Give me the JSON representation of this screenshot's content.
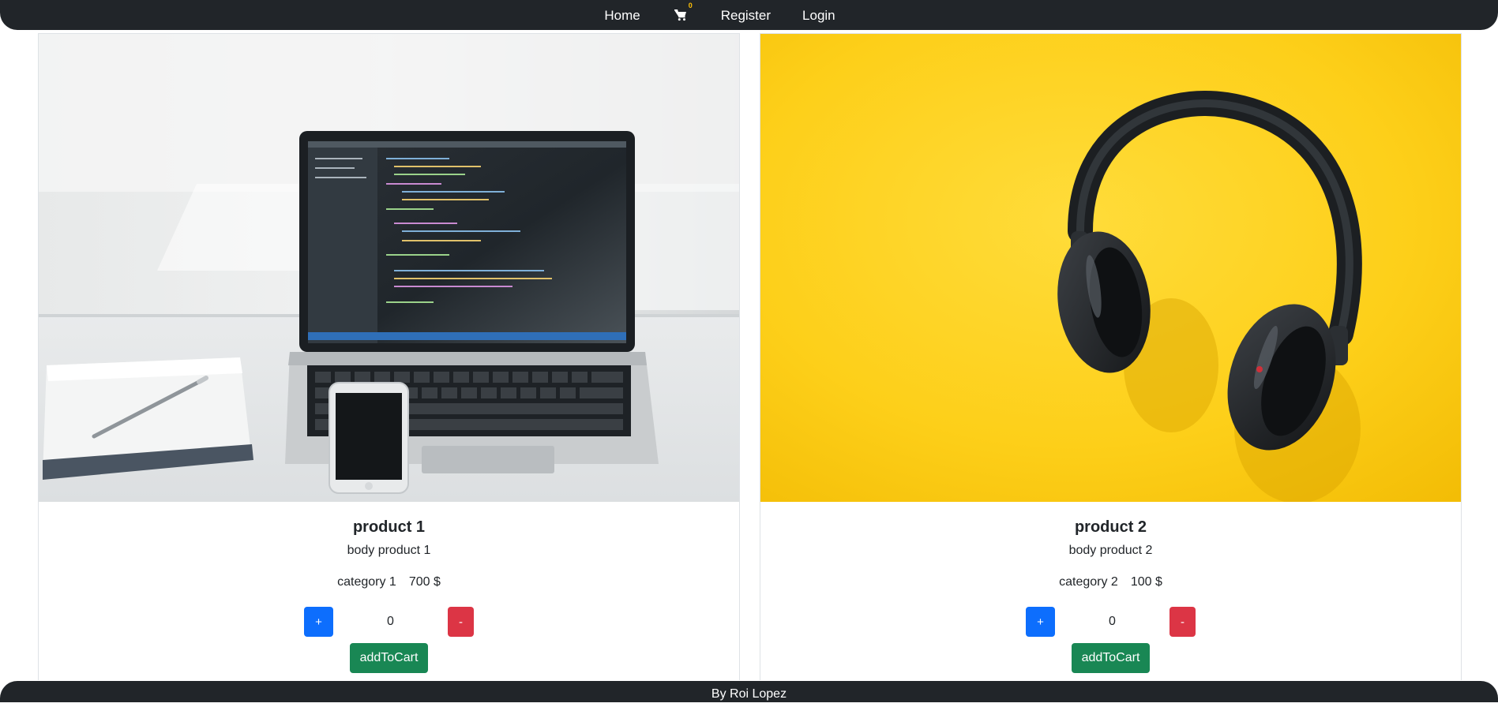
{
  "nav": {
    "home": "Home",
    "cart_icon": "cart-icon",
    "cart_count": "0",
    "register": "Register",
    "login": "Login"
  },
  "products": [
    {
      "image": "laptop-desk-photo",
      "title": "product 1",
      "body": "body product 1",
      "category": "category 1",
      "price": "700 $",
      "plus": "+",
      "quantity": "0",
      "minus": "-",
      "add": "addToCart"
    },
    {
      "image": "headphones-yellow-photo",
      "title": "product 2",
      "body": "body product 2",
      "category": "category 2",
      "price": "100 $",
      "plus": "+",
      "quantity": "0",
      "minus": "-",
      "add": "addToCart"
    }
  ],
  "footer": {
    "text": "By Roi Lopez"
  },
  "colors": {
    "navbar": "#212529",
    "primary": "#0d6efd",
    "danger": "#dc3545",
    "success": "#198754",
    "badge": "#ffc107"
  }
}
